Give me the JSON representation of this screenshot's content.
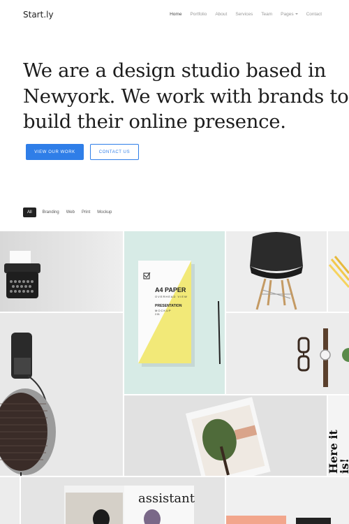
{
  "nav": {
    "brand": "Start.ly",
    "items": [
      {
        "label": "Home",
        "active": true
      },
      {
        "label": "Portfolio",
        "active": false
      },
      {
        "label": "About",
        "active": false
      },
      {
        "label": "Services",
        "active": false
      },
      {
        "label": "Team",
        "active": false
      },
      {
        "label": "Pages",
        "active": false,
        "dropdown": true
      },
      {
        "label": "Contact",
        "active": false
      }
    ]
  },
  "hero": {
    "line1": "We are a design studio based in",
    "line2": "Newyork. We work with brands to",
    "line3": "build their online presence."
  },
  "buttons": {
    "primary": "VIEW OUR WORK",
    "secondary": "CONTACT US"
  },
  "filters": [
    "All",
    "Branding",
    "Web",
    "Print",
    "Mockup"
  ],
  "portfolio": {
    "paper_title": "A4 PAPER",
    "paper_sub": "OVERHEAD VIEW",
    "paper_heading": "PRESENTATION",
    "paper_mockup": "MOCKUP",
    "paper_version": "2.01",
    "sign_text1": "Here",
    "sign_text2": "it is!",
    "book_title": "assistant"
  },
  "colors": {
    "accent": "#2f7ee8",
    "text": "#1c1c1c"
  }
}
